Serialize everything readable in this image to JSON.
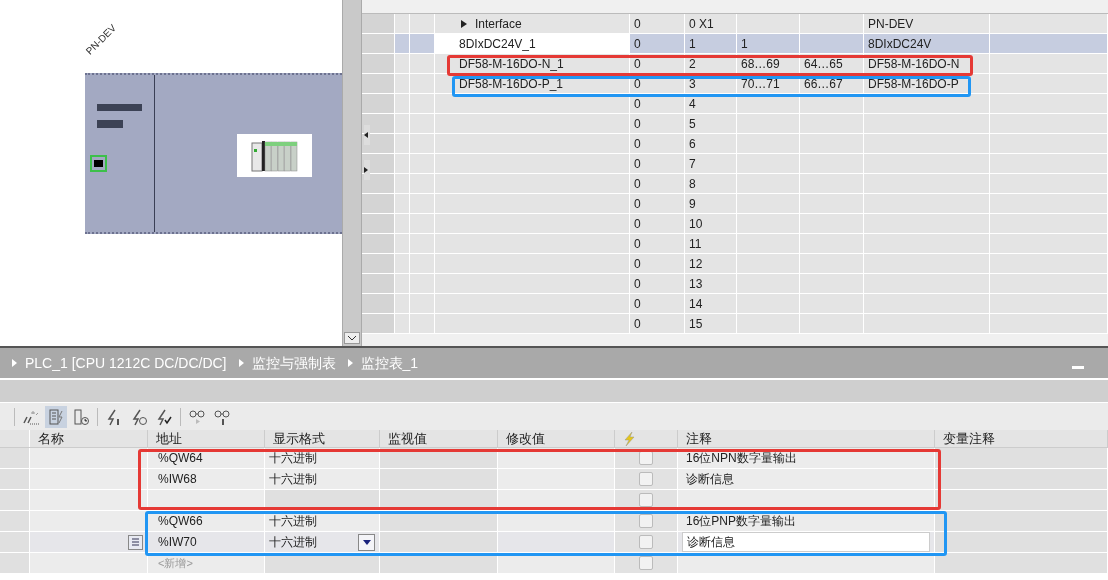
{
  "device_view": {
    "device_label": "PN-DEV"
  },
  "module_table": {
    "rows": [
      {
        "kind": "interface",
        "expanded": false,
        "selected": false,
        "module": "Interface",
        "rack": "0",
        "slot": "0 X1",
        "type": "PN-DEV"
      },
      {
        "kind": "module",
        "selected": true,
        "module": "8DIxDC24V_1",
        "rack": "0",
        "slot": "1",
        "i_address": "1",
        "type": "8DIxDC24V"
      },
      {
        "kind": "module",
        "selected": false,
        "module": "DF58-M-16DO-N_1",
        "rack": "0",
        "slot": "2",
        "i_address": "68…69",
        "q_address": "64…65",
        "type": "DF58-M-16DO-N"
      },
      {
        "kind": "module",
        "selected": false,
        "module": "DF58-M-16DO-P_1",
        "rack": "0",
        "slot": "3",
        "i_address": "70…71",
        "q_address": "66…67",
        "type": "DF58-M-16DO-P"
      },
      {
        "kind": "empty",
        "selected": false,
        "rack": "0",
        "slot": "4"
      },
      {
        "kind": "empty",
        "selected": false,
        "rack": "0",
        "slot": "5"
      },
      {
        "kind": "empty",
        "selected": false,
        "rack": "0",
        "slot": "6"
      },
      {
        "kind": "empty",
        "selected": false,
        "rack": "0",
        "slot": "7"
      },
      {
        "kind": "empty",
        "selected": false,
        "rack": "0",
        "slot": "8"
      },
      {
        "kind": "empty",
        "selected": false,
        "rack": "0",
        "slot": "9"
      },
      {
        "kind": "empty",
        "selected": false,
        "rack": "0",
        "slot": "10"
      },
      {
        "kind": "empty",
        "selected": false,
        "rack": "0",
        "slot": "11"
      },
      {
        "kind": "empty",
        "selected": false,
        "rack": "0",
        "slot": "12"
      },
      {
        "kind": "empty",
        "selected": false,
        "rack": "0",
        "slot": "13"
      },
      {
        "kind": "empty",
        "selected": false,
        "rack": "0",
        "slot": "14"
      },
      {
        "kind": "empty",
        "selected": false,
        "rack": "0",
        "slot": "15"
      }
    ]
  },
  "breadcrumb": [
    "PLC_1 [CPU 1212C DC/DC/DC]",
    "监控与强制表",
    "监控表_1"
  ],
  "toolbar": [
    {
      "selected": false
    },
    {
      "selected": true
    },
    {
      "selected": false
    },
    {
      "selected": false
    },
    {
      "selected": false
    },
    {
      "selected": false
    },
    {
      "selected": false
    },
    {
      "selected": false
    }
  ],
  "watch_table": {
    "columns": [
      {
        "kind": "text",
        "label": "名称"
      },
      {
        "kind": "text",
        "label": "地址"
      },
      {
        "kind": "text",
        "label": "显示格式"
      },
      {
        "kind": "text",
        "label": "监视值"
      },
      {
        "kind": "text",
        "label": "修改值"
      },
      {
        "kind": "icon"
      },
      {
        "kind": "text",
        "label": "注释"
      },
      {
        "kind": "text",
        "label": "变量注释"
      }
    ],
    "rows": [
      {
        "kind": "entry",
        "editing": false,
        "checked": false,
        "address": "%QW64",
        "format": "十六进制",
        "comment": "16位NPN数字量输出"
      },
      {
        "kind": "entry",
        "editing": false,
        "checked": false,
        "address": "%IW68",
        "format": "十六进制",
        "comment": "诊断信息"
      },
      {
        "kind": "empty",
        "editing": false,
        "checked": false
      },
      {
        "kind": "entry",
        "editing": false,
        "checked": false,
        "address": "%QW66",
        "format": "十六进制",
        "comment": "16位PNP数字量输出"
      },
      {
        "kind": "entry",
        "editing": true,
        "checked": false,
        "address": "%IW70",
        "format": "十六进制",
        "comment": "诊断信息"
      },
      {
        "kind": "new",
        "editing": false,
        "checked": false,
        "address": "<新增>"
      }
    ]
  },
  "annotations": [
    {
      "color": "#e53935"
    },
    {
      "color": "#2196f3"
    },
    {
      "color": "#e53935"
    },
    {
      "color": "#2196f3"
    }
  ]
}
